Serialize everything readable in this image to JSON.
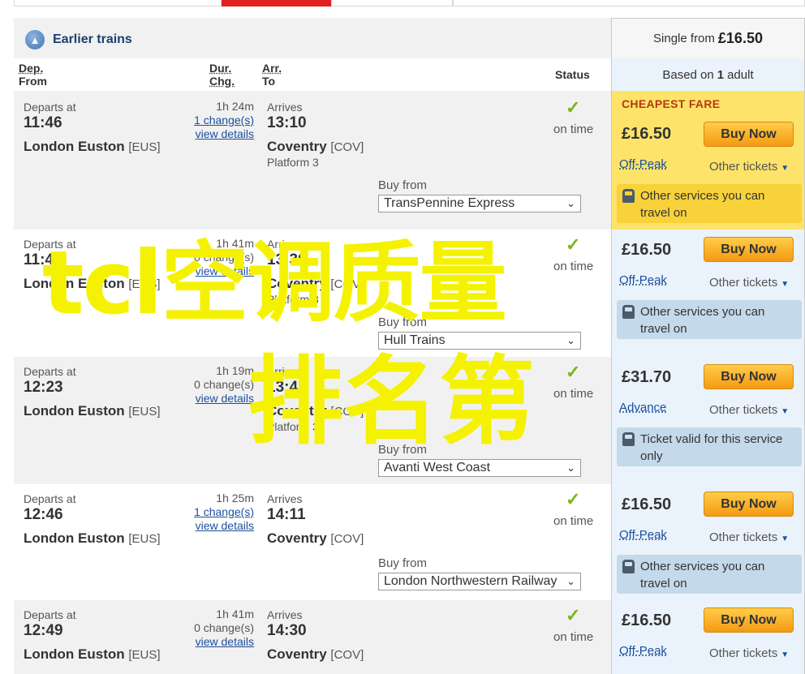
{
  "earlier_trains": "Earlier trains",
  "single_from": {
    "prefix": "Single from",
    "price": "£16.50"
  },
  "based_on": {
    "prefix": "Based on",
    "count": "1",
    "suffix": "adult"
  },
  "headers": {
    "dep": "Dep.",
    "from": "From",
    "dur": "Dur.",
    "chg": "Chg.",
    "arr": "Arr.",
    "to": "To",
    "status": "Status"
  },
  "common": {
    "departs_at": "Departs at",
    "arrives": "Arrives",
    "on_time": "on time",
    "buy_from": "Buy from",
    "buy_now": "Buy Now",
    "other_tickets": "Other tickets",
    "view_details": "view details"
  },
  "cheapest_label": "CHEAPEST FARE",
  "journeys": [
    {
      "dep_time": "11:46",
      "from": "London Euston",
      "from_code": "[EUS]",
      "duration": "1h 24m",
      "changes": "1 change(s)",
      "changes_link": true,
      "arr_time": "13:10",
      "to": "Coventry",
      "to_code": "[COV]",
      "platform": "Platform 3",
      "operator": "TransPennine Express",
      "price": "£16.50",
      "fare_type": "Off-Peak",
      "note": "Other services you can travel on",
      "cheapest": true
    },
    {
      "dep_time": "11:49",
      "from": "London Euston",
      "from_code": "[EUS]",
      "duration": "1h 41m",
      "changes": "0 change(s)",
      "changes_link": false,
      "arr_time": "13:30",
      "to": "Coventry",
      "to_code": "[COV]",
      "platform": "Platform 3",
      "operator": "Hull Trains",
      "price": "£16.50",
      "fare_type": "Off-Peak",
      "note": "Other services you can travel on",
      "cheapest": false
    },
    {
      "dep_time": "12:23",
      "from": "London Euston",
      "from_code": "[EUS]",
      "duration": "1h 19m",
      "changes": "0 change(s)",
      "changes_link": false,
      "arr_time": "13:42",
      "to": "Coventry",
      "to_code": "[COV]",
      "platform": "Platform 3",
      "operator": "Avanti West Coast",
      "price": "£31.70",
      "fare_type": "Advance",
      "note": "Ticket valid for this service only",
      "cheapest": false
    },
    {
      "dep_time": "12:46",
      "from": "London Euston",
      "from_code": "[EUS]",
      "duration": "1h 25m",
      "changes": "1 change(s)",
      "changes_link": true,
      "arr_time": "14:11",
      "to": "Coventry",
      "to_code": "[COV]",
      "platform": "",
      "operator": "London Northwestern Railway",
      "price": "£16.50",
      "fare_type": "Off-Peak",
      "note": "Other services you can travel on",
      "cheapest": false
    },
    {
      "dep_time": "12:49",
      "from": "London Euston",
      "from_code": "[EUS]",
      "duration": "1h 41m",
      "changes": "0 change(s)",
      "changes_link": false,
      "arr_time": "14:30",
      "to": "Coventry",
      "to_code": "[COV]",
      "platform": "",
      "operator": "",
      "price": "£16.50",
      "fare_type": "Off-Peak",
      "note": "",
      "cheapest": false
    }
  ],
  "watermark": {
    "line1": "tcl空调质量",
    "line2": "排名第"
  },
  "colors": {
    "accent_red": "#e0201e",
    "buy_orange": "#f49a12",
    "cheapest_yellow": "#fde36a",
    "fare_blue": "#eaf3fb",
    "check_green": "#7cb518",
    "watermark_yellow": "#f4f200"
  }
}
